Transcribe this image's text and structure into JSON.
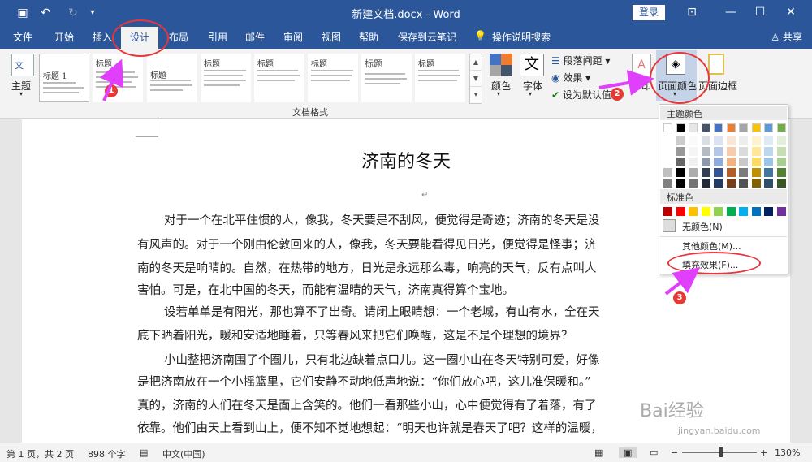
{
  "window": {
    "title": "新建文档.docx - Word",
    "login": "登录"
  },
  "tabs": [
    "文件",
    "开始",
    "插入",
    "设计",
    "布局",
    "引用",
    "邮件",
    "审阅",
    "视图",
    "帮助",
    "保存到云笔记",
    "操作说明搜索"
  ],
  "share": "共享",
  "ribbon": {
    "theme_label": "主题",
    "gallery_titles": [
      "标题 1",
      "标题",
      "标题",
      "标题",
      "标题",
      "标题",
      "标题",
      "标题"
    ],
    "colors_label": "颜色",
    "fonts_label": "字体",
    "paragraph_spacing": "段落间距",
    "effects": "效果",
    "set_default": "设为默认值",
    "watermark_label": "印",
    "page_color": "页面颜色",
    "page_border": "页面边框",
    "group_label": "文档格式"
  },
  "dropdown": {
    "theme_colors_header": "主题颜色",
    "standard_colors_header": "标准色",
    "no_color": "无颜色(N)",
    "more_colors": "其他颜色(M)...",
    "fill_effects": "填充效果(F)...",
    "theme_colors": [
      "#ffffff",
      "#000000",
      "#e7e6e6",
      "#44546a",
      "#4472c4",
      "#ed7d31",
      "#a5a5a5",
      "#ffc000",
      "#5b9bd5",
      "#70ad47"
    ],
    "standard_colors": [
      "#c00000",
      "#ff0000",
      "#ffc000",
      "#ffff00",
      "#92d050",
      "#00b050",
      "#00b0f0",
      "#0070c0",
      "#002060",
      "#7030a0"
    ]
  },
  "document": {
    "title": "济南的冬天",
    "lines": [
      "对于一个在北平住惯的人，像我，冬天要是不刮风，便觉得是奇迹；济南的冬天是没",
      "有风声的。对于一个刚由伦敦回来的人，像我，冬天要能看得见日光，便觉得是怪事；济",
      "南的冬天是响晴的。自然，在热带的地方，日光是永远那么毒，响亮的天气，反有点叫人",
      "害怕。可是，在北中国的冬天，而能有温晴的天气，济南真得算个宝地。",
      "设若单单是有阳光，那也算不了出奇。请闭上眼睛想：一个老城，有山有水，全在天",
      "底下晒着阳光，暖和安适地睡着，只等春风来把它们唤醒，这是不是个理想的境界？",
      "小山整把济南围了个圈儿，只有北边缺着点口儿。这一圈小山在冬天特别可爱，好像",
      "是把济南放在一个小摇篮里，它们安静不动地低声地说：“你们放心吧，这儿准保暖和。”",
      "真的，济南的人们在冬天是面上含笑的。他们一看那些小山，心中便觉得有了着落，有了",
      "依靠。他们由天上看到山上，便不知不觉地想起：“明天也许就是春天了吧？这样的温暖，"
    ]
  },
  "status": {
    "page": "第 1 页，共 2 页",
    "words": "898 个字",
    "lang": "中文(中国)",
    "zoom": "130%"
  },
  "annotations": {
    "badge1": "1",
    "badge2": "2",
    "badge3": "3"
  },
  "watermark": {
    "text1": "Bai",
    "text2": "经验",
    "url": "jingyan.baidu.com"
  }
}
